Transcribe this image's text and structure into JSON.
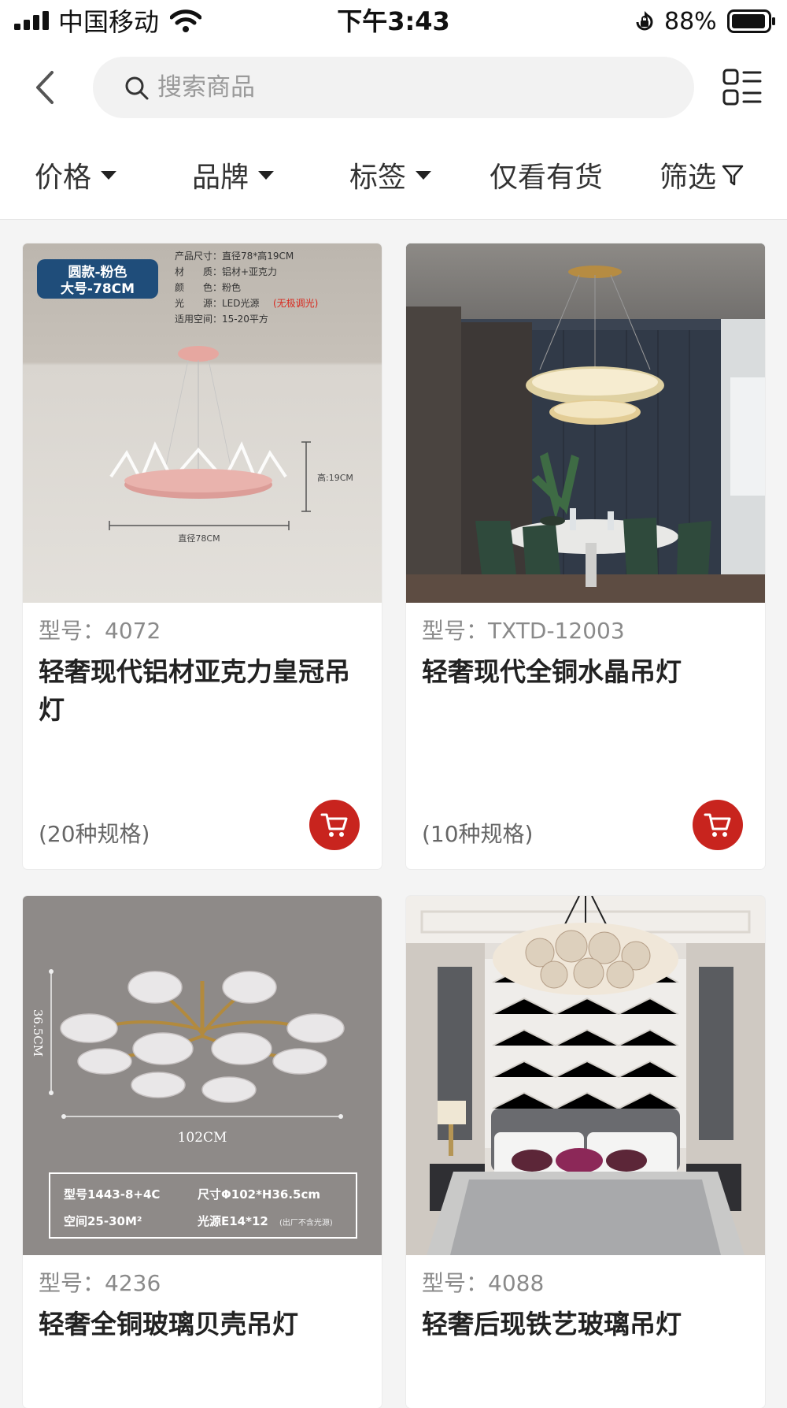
{
  "status_bar": {
    "carrier": "中国移动",
    "time": "下午3:43",
    "battery": "88%"
  },
  "header": {
    "search_placeholder": "搜索商品",
    "icons": {
      "back": "back-chevron-icon",
      "search": "search-icon",
      "layout": "list-layout-icon"
    }
  },
  "filters": {
    "price": "价格",
    "brand": "品牌",
    "tags": "标签",
    "in_stock": "仅看有货",
    "filter": "筛选"
  },
  "products": [
    {
      "model_label": "型号：",
      "model": "4072",
      "name": "轻奢现代铝材亚克力皇冠吊灯",
      "specs": "(20种规格)",
      "image": {
        "badge_line1": "圆款-粉色",
        "badge_line2": "大号-78CM",
        "info": [
          "产品尺寸：直径78*高19CM",
          "材　　质：铝材+亚克力",
          "颜　　色：粉色",
          "光　　源：LED光源",
          "适用空间：15-20平方"
        ],
        "info_highlight": "(无极调光)",
        "height_label": "高:19CM",
        "width_label": "直径78CM"
      }
    },
    {
      "model_label": "型号：",
      "model": "TXTD-12003",
      "name": "轻奢现代全铜水晶吊灯",
      "specs": "(10种规格)",
      "image": {}
    },
    {
      "model_label": "型号：",
      "model": "4236",
      "name": "轻奢全铜玻璃贝壳吊灯",
      "image": {
        "height_label": "36.5CM",
        "width_label": "102CM",
        "spec_model": "型号1443-8+4C",
        "spec_size": "尺寸Φ102*H36.5cm",
        "spec_space": "空间25-30M²",
        "spec_light": "光源E14*12",
        "spec_light_note": "(出厂不含光源)"
      }
    },
    {
      "model_label": "型号：",
      "model": "4088",
      "name": "轻奢后现铁艺玻璃吊灯",
      "image": {}
    }
  ],
  "colors": {
    "accent": "#c8241e",
    "text": "#222222",
    "muted": "#8a8a8a"
  }
}
